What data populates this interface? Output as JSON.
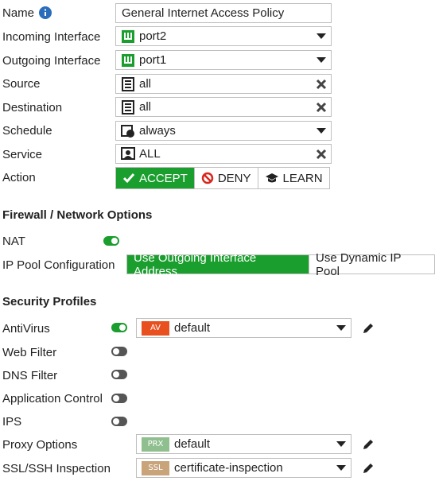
{
  "fields": {
    "name_label": "Name",
    "name_value": "General Internet Access Policy",
    "incoming_label": "Incoming Interface",
    "incoming_value": "port2",
    "outgoing_label": "Outgoing Interface",
    "outgoing_value": "port1",
    "source_label": "Source",
    "source_value": "all",
    "destination_label": "Destination",
    "destination_value": "all",
    "schedule_label": "Schedule",
    "schedule_value": "always",
    "service_label": "Service",
    "service_value": "ALL",
    "action_label": "Action"
  },
  "action": {
    "options": [
      "ACCEPT",
      "DENY",
      "LEARN"
    ],
    "selected": "ACCEPT"
  },
  "firewall": {
    "title": "Firewall / Network Options",
    "nat_label": "NAT",
    "nat_enabled": true,
    "ippool_label": "IP Pool Configuration",
    "ippool_options": [
      "Use Outgoing Interface Address",
      "Use Dynamic IP Pool"
    ],
    "ippool_selected": "Use Outgoing Interface Address"
  },
  "security": {
    "title": "Security Profiles",
    "antivirus_label": "AntiVirus",
    "antivirus_enabled": true,
    "antivirus_badge": "AV",
    "antivirus_value": "default",
    "webfilter_label": "Web Filter",
    "webfilter_enabled": false,
    "dnsfilter_label": "DNS Filter",
    "dnsfilter_enabled": false,
    "appcontrol_label": "Application Control",
    "appcontrol_enabled": false,
    "ips_label": "IPS",
    "ips_enabled": false,
    "proxy_label": "Proxy Options",
    "proxy_badge": "PRX",
    "proxy_value": "default",
    "ssl_label": "SSL/SSH Inspection",
    "ssl_badge": "SSL",
    "ssl_value": "certificate-inspection"
  },
  "colors": {
    "accent_green": "#1a9e2e",
    "av_badge": "#e8501f",
    "prx_badge": "#8fbf8f",
    "ssl_badge": "#c9a37a",
    "info_blue": "#2a6ebb"
  }
}
